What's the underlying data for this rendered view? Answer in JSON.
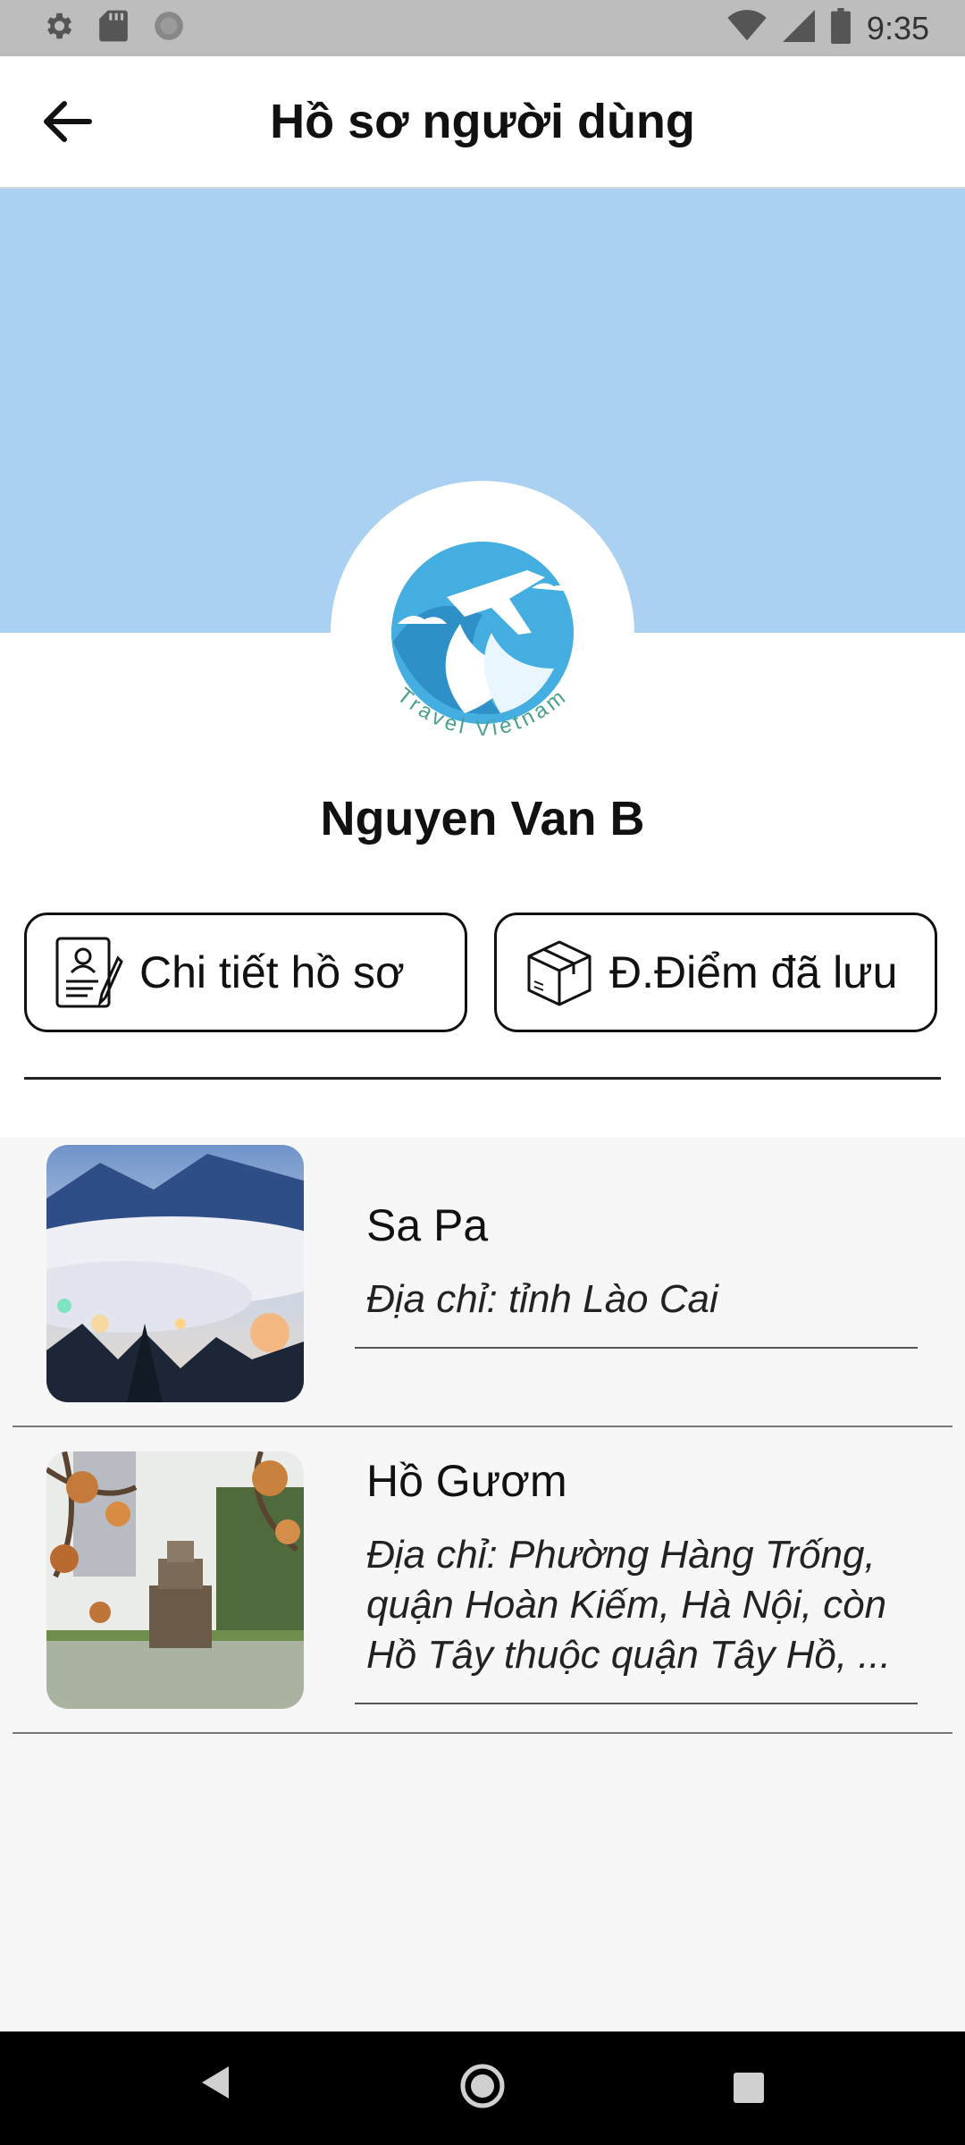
{
  "status_bar": {
    "time": "9:35",
    "left_icons": [
      "gear-icon",
      "sd-card-icon",
      "circle-notification-icon"
    ],
    "right_icons": [
      "wifi-icon",
      "signal-icon",
      "battery-icon"
    ]
  },
  "app_bar": {
    "title": "Hồ sơ người dùng",
    "back_icon": "arrow-left-icon"
  },
  "profile": {
    "name": "Nguyen Van B",
    "logo_text": "Travel Vietnam",
    "cover_color": "#aad1f2",
    "logo_color": "#45aee0"
  },
  "actions": {
    "profile_details": {
      "label": "Chi tiết hồ sơ",
      "icon": "profile-document-icon"
    },
    "saved_places": {
      "label": "Đ.Điểm đã lưu",
      "icon": "box-icon"
    }
  },
  "saved_places": [
    {
      "title": "Sa Pa",
      "address": "Địa chỉ: tỉnh Lào Cai"
    },
    {
      "title": "Hồ Gươm",
      "address": "Địa chỉ: Phường Hàng Trống, quận Hoàn Kiếm, Hà Nội, còn Hồ Tây thuộc quận Tây Hồ, ..."
    }
  ],
  "nav_bar": {
    "buttons": [
      "back-triangle-icon",
      "home-circle-icon",
      "recents-square-icon"
    ]
  }
}
